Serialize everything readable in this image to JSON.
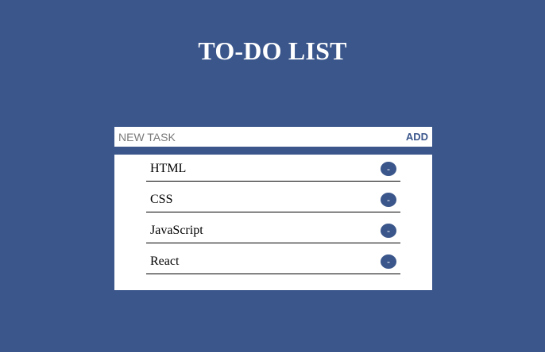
{
  "page": {
    "title": "TO-DO LIST",
    "background_color": "#3a568b"
  },
  "input": {
    "placeholder": "NEW TASK",
    "value": "",
    "add_label": "ADD"
  },
  "tasks": [
    {
      "text": "HTML",
      "remove_label": "-"
    },
    {
      "text": "CSS",
      "remove_label": "-"
    },
    {
      "text": "JavaScript",
      "remove_label": "-"
    },
    {
      "text": "React",
      "remove_label": "-"
    }
  ],
  "colors": {
    "accent": "#3a568b",
    "panel": "#ffffff",
    "divider": "#000000"
  }
}
